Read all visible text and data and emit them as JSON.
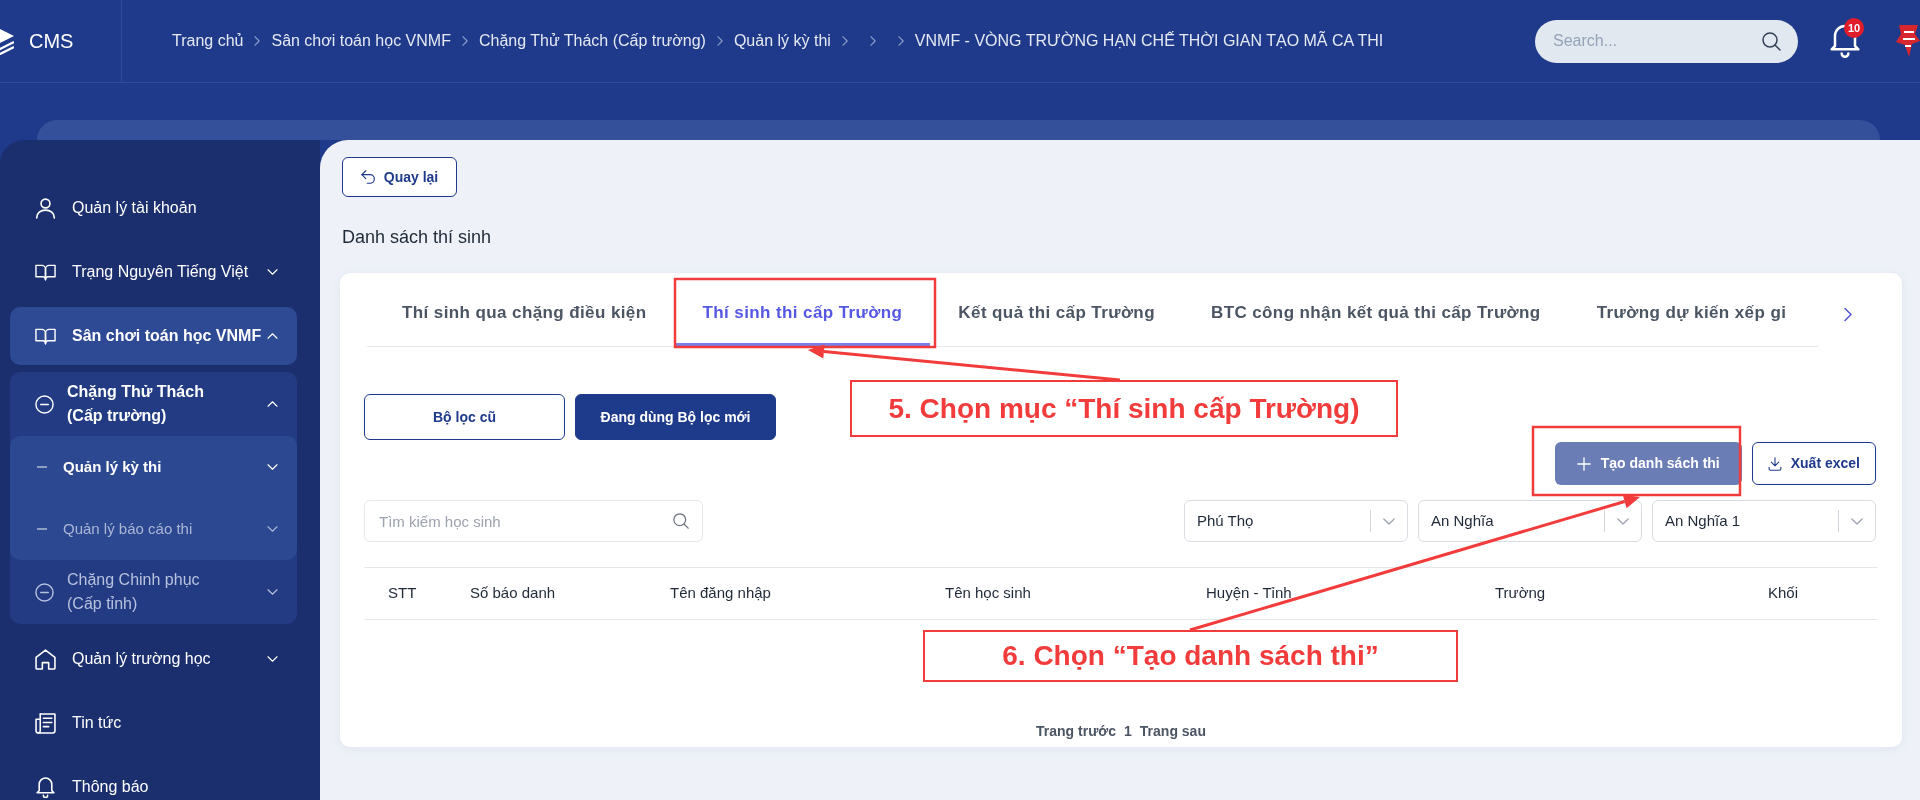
{
  "header": {
    "logo": "CMS",
    "breadcrumb": [
      {
        "kind": "link",
        "label": "Trang chủ"
      },
      {
        "kind": "separator"
      },
      {
        "kind": "link",
        "label": "Sân chơi toán học VNMF"
      },
      {
        "kind": "separator"
      },
      {
        "kind": "link",
        "label": "Chặng Thử Thách (Cấp trường)"
      },
      {
        "kind": "separator"
      },
      {
        "kind": "link",
        "label": "Quản lý kỳ thi"
      },
      {
        "kind": "separator"
      },
      {
        "kind": "separator"
      },
      {
        "kind": "separator"
      },
      {
        "kind": "current",
        "label": "VNMF - VÒNG TRƯỜNG HẠN CHẾ THỜI GIAN TẠO MÃ CA THI"
      }
    ],
    "search": {
      "placeholder": "Search..."
    },
    "notification_count": "10"
  },
  "sidebar": {
    "items": [
      {
        "kind": "link",
        "label": "Quản lý tài khoản",
        "selected": false
      },
      {
        "kind": "group",
        "label": "Trạng Nguyên Tiếng Việt",
        "selected": false,
        "expanded": false
      },
      {
        "kind": "group",
        "label": "Sân chơi toán học VNMF",
        "selected": true,
        "expanded": true,
        "children": [
          {
            "label": "Chặng Thử Thách (Cấp trường)",
            "selected": true,
            "expanded": true,
            "children": [
              {
                "label": "Quản lý kỳ thi",
                "selected": true,
                "expanded": false
              },
              {
                "label": "Quản lý báo cáo thi",
                "selected": false,
                "expanded": false
              }
            ]
          },
          {
            "label": "Chặng Chinh phục (Cấp tỉnh)",
            "selected": false,
            "expanded": false
          }
        ]
      },
      {
        "kind": "group",
        "label": "Quản lý trường học",
        "selected": false,
        "expanded": false
      },
      {
        "kind": "link",
        "label": "Tin tức",
        "selected": false
      },
      {
        "kind": "link",
        "label": "Thông báo",
        "selected": false
      }
    ]
  },
  "main": {
    "back_button": "Quay lại",
    "title": "Danh sách thí sinh",
    "tabs": [
      {
        "label": "Thí sinh qua chặng điều kiện",
        "selected": false
      },
      {
        "label": "Thí sinh thi cấp Trường",
        "selected": true
      },
      {
        "label": "Kết quả thi cấp Trường",
        "selected": false
      },
      {
        "label": "BTC công nhận kết quả thi cấp Trường",
        "selected": false
      },
      {
        "label": "Trường dự kiến xếp gi",
        "selected": false
      }
    ],
    "filter_modes": [
      {
        "label": "Bộ lọc cũ",
        "selected": false
      },
      {
        "label": "Đang dùng Bộ lọc mới",
        "selected": true
      }
    ],
    "actions": [
      {
        "kind": "filled",
        "label": "Tạo danh sách thi"
      },
      {
        "kind": "outlined",
        "label": "Xuất excel"
      }
    ],
    "search": {
      "placeholder": "Tìm kiếm học sinh"
    },
    "selects": [
      {
        "value": "Phú Thọ"
      },
      {
        "value": "An Nghĩa"
      },
      {
        "value": "An Nghĩa 1"
      }
    ],
    "table": {
      "columns": [
        "STT",
        "Số báo danh",
        "Tên đăng nhập",
        "Tên học sinh",
        "Huyện - Tỉnh",
        "Trường",
        "Khối"
      ]
    },
    "pagination": {
      "previous": "Trang trước",
      "page": "1",
      "next": "Trang sau"
    }
  },
  "callouts": [
    {
      "text": "5. Chọn mục “Thí sinh cấp Trường)"
    },
    {
      "text": "6. Chọn “Tạo danh sách thi”"
    }
  ]
}
